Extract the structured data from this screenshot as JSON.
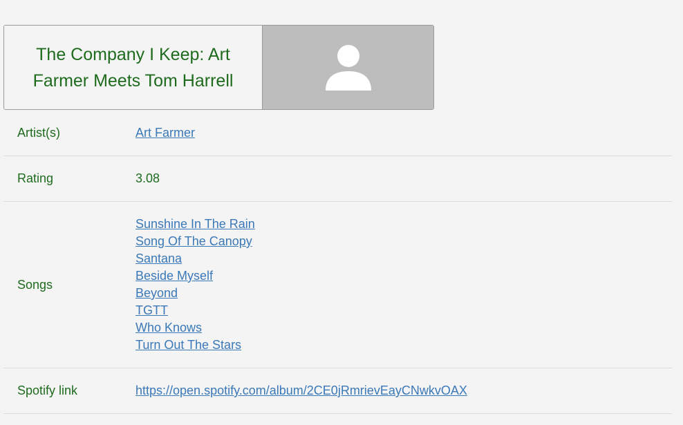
{
  "album": {
    "title": "The Company I Keep: Art Farmer Meets Tom Harrell",
    "art_icon": "person-placeholder-icon"
  },
  "details": {
    "artist_label": "Artist(s)",
    "artist_value": "Art Farmer",
    "rating_label": "Rating",
    "rating_value": "3.08",
    "songs_label": "Songs",
    "songs": [
      "Sunshine In The Rain",
      "Song Of The Canopy",
      "Santana",
      "Beside Myself",
      "Beyond",
      "TGTT",
      "Who Knows",
      "Turn Out The Stars"
    ],
    "spotify_label": "Spotify link",
    "spotify_value": "https://open.spotify.com/album/2CE0jRmrievEayCNwkvOAX"
  },
  "colors": {
    "text_green": "#1e6b1e",
    "link_blue": "#3a78b8",
    "background": "#f4f4f4",
    "art_gray": "#bdbdbd"
  }
}
